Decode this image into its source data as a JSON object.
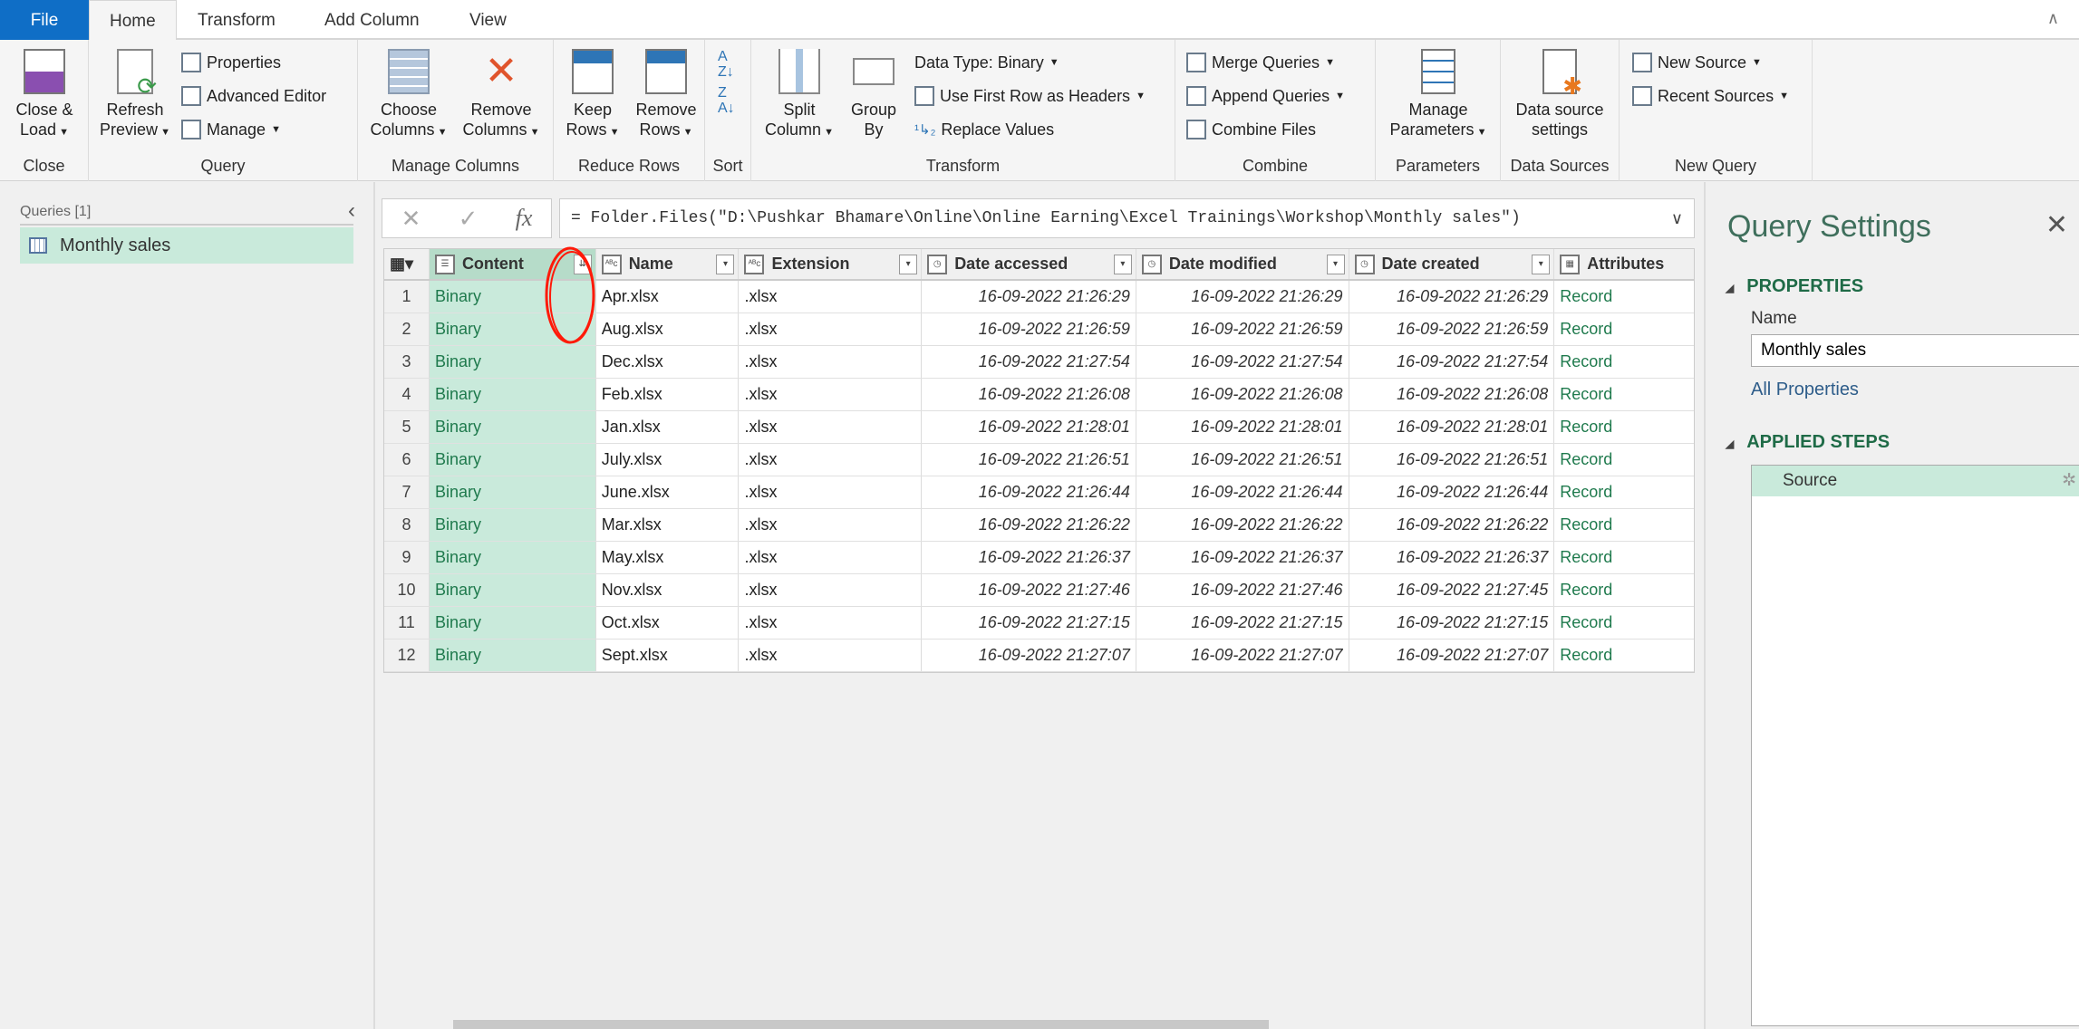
{
  "tabs": {
    "file": "File",
    "home": "Home",
    "transform": "Transform",
    "add_column": "Add Column",
    "view": "View"
  },
  "ribbon": {
    "close": {
      "label": "Close",
      "close_load": "Close &",
      "close_load2": "Load"
    },
    "query": {
      "label": "Query",
      "refresh": "Refresh",
      "refresh2": "Preview",
      "properties": "Properties",
      "advanced_editor": "Advanced Editor",
      "manage": "Manage"
    },
    "manage_columns": {
      "label": "Manage Columns",
      "choose": "Choose",
      "choose2": "Columns",
      "remove": "Remove",
      "remove2": "Columns"
    },
    "reduce_rows": {
      "label": "Reduce Rows",
      "keep": "Keep",
      "keep2": "Rows",
      "remove": "Remove",
      "remove2": "Rows"
    },
    "sort": {
      "label": "Sort"
    },
    "transform": {
      "label": "Transform",
      "split": "Split",
      "split2": "Column",
      "group": "Group",
      "group2": "By",
      "data_type": "Data Type: Binary",
      "first_row": "Use First Row as Headers",
      "replace": "Replace Values"
    },
    "combine": {
      "label": "Combine",
      "merge": "Merge Queries",
      "append": "Append Queries",
      "combine_files": "Combine Files"
    },
    "parameters": {
      "label": "Parameters",
      "manage": "Manage",
      "manage2": "Parameters"
    },
    "data_sources": {
      "label": "Data Sources",
      "settings": "Data source",
      "settings2": "settings"
    },
    "new_query": {
      "label": "New Query",
      "new_source": "New Source",
      "recent": "Recent Sources"
    }
  },
  "queries": {
    "header": "Queries [1]",
    "items": [
      {
        "label": "Monthly sales"
      }
    ]
  },
  "formula": "= Folder.Files(\"D:\\Pushkar Bhamare\\Online\\Online Earning\\Excel Trainings\\Workshop\\Monthly sales\")",
  "columns": [
    "Content",
    "Name",
    "Extension",
    "Date accessed",
    "Date modified",
    "Date created",
    "Attributes"
  ],
  "rows": [
    [
      "1",
      "Binary",
      "Apr.xlsx",
      ".xlsx",
      "16-09-2022 21:26:29",
      "16-09-2022 21:26:29",
      "16-09-2022 21:26:29",
      "Record"
    ],
    [
      "2",
      "Binary",
      "Aug.xlsx",
      ".xlsx",
      "16-09-2022 21:26:59",
      "16-09-2022 21:26:59",
      "16-09-2022 21:26:59",
      "Record"
    ],
    [
      "3",
      "Binary",
      "Dec.xlsx",
      ".xlsx",
      "16-09-2022 21:27:54",
      "16-09-2022 21:27:54",
      "16-09-2022 21:27:54",
      "Record"
    ],
    [
      "4",
      "Binary",
      "Feb.xlsx",
      ".xlsx",
      "16-09-2022 21:26:08",
      "16-09-2022 21:26:08",
      "16-09-2022 21:26:08",
      "Record"
    ],
    [
      "5",
      "Binary",
      "Jan.xlsx",
      ".xlsx",
      "16-09-2022 21:28:01",
      "16-09-2022 21:28:01",
      "16-09-2022 21:28:01",
      "Record"
    ],
    [
      "6",
      "Binary",
      "July.xlsx",
      ".xlsx",
      "16-09-2022 21:26:51",
      "16-09-2022 21:26:51",
      "16-09-2022 21:26:51",
      "Record"
    ],
    [
      "7",
      "Binary",
      "June.xlsx",
      ".xlsx",
      "16-09-2022 21:26:44",
      "16-09-2022 21:26:44",
      "16-09-2022 21:26:44",
      "Record"
    ],
    [
      "8",
      "Binary",
      "Mar.xlsx",
      ".xlsx",
      "16-09-2022 21:26:22",
      "16-09-2022 21:26:22",
      "16-09-2022 21:26:22",
      "Record"
    ],
    [
      "9",
      "Binary",
      "May.xlsx",
      ".xlsx",
      "16-09-2022 21:26:37",
      "16-09-2022 21:26:37",
      "16-09-2022 21:26:37",
      "Record"
    ],
    [
      "10",
      "Binary",
      "Nov.xlsx",
      ".xlsx",
      "16-09-2022 21:27:46",
      "16-09-2022 21:27:46",
      "16-09-2022 21:27:45",
      "Record"
    ],
    [
      "11",
      "Binary",
      "Oct.xlsx",
      ".xlsx",
      "16-09-2022 21:27:15",
      "16-09-2022 21:27:15",
      "16-09-2022 21:27:15",
      "Record"
    ],
    [
      "12",
      "Binary",
      "Sept.xlsx",
      ".xlsx",
      "16-09-2022 21:27:07",
      "16-09-2022 21:27:07",
      "16-09-2022 21:27:07",
      "Record"
    ]
  ],
  "settings": {
    "title": "Query Settings",
    "properties": "PROPERTIES",
    "name_label": "Name",
    "name_value": "Monthly sales",
    "all_properties": "All Properties",
    "applied_steps": "APPLIED STEPS",
    "steps": [
      {
        "label": "Source"
      }
    ]
  }
}
